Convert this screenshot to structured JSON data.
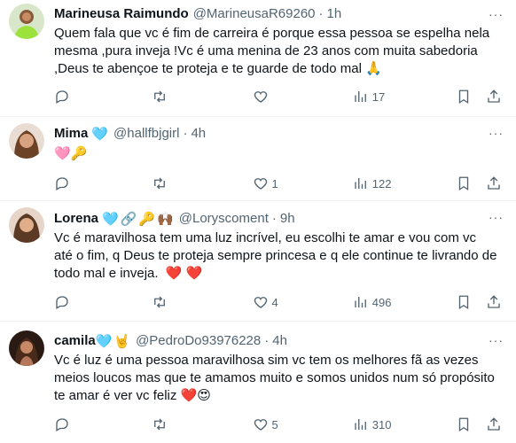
{
  "tweets": [
    {
      "name": "Marineusa Raimundo",
      "handle": "@MarineusaR69260",
      "time": "1h",
      "text": "Quem fala que vc é fim de carreira é porque essa pessoa se espelha nela mesma ,pura inveja !Vc é uma menina de 23 anos com muita sabedoria ,Deus te abençoe te proteja e te guarde de todo mal 🙏",
      "name_emojis": [],
      "reply_count": "",
      "retweet_count": "",
      "like_count": "",
      "view_count": "17",
      "avatar": "avatar-woman-green"
    },
    {
      "name": "Mima",
      "handle": "@hallfbjgirl",
      "time": "4h",
      "text": "🩷🔑",
      "name_emojis": [
        "🩵"
      ],
      "reply_count": "",
      "retweet_count": "",
      "like_count": "1",
      "view_count": "122",
      "avatar": "avatar-woman-brown"
    },
    {
      "name": "Lorena",
      "handle": "@Loryscoment",
      "time": "9h",
      "text": "Vc é maravilhosa tem uma luz incrível, eu escolhi te amar e vou com vc até o fim, q Deus te proteja sempre princesa e q ele continue te livrando de todo mal e inveja.  ❤️ ❤️",
      "name_emojis": [
        "🩵",
        "🔗",
        "🔑",
        "🙌🏾"
      ],
      "reply_count": "",
      "retweet_count": "",
      "like_count": "4",
      "view_count": "496",
      "avatar": "avatar-woman-smile"
    },
    {
      "name": "camila",
      "handle": "@PedroDo93976228",
      "time": "4h",
      "text": "Vc é luz é uma pessoa maravilhosa sim vc tem os melhores fã as vezes meios loucos mas que te amamos muito e somos unidos num só propósito te amar é ver vc feliz ❤️😍",
      "name_emojis": [
        "🩵",
        "🤘"
      ],
      "reply_count": "",
      "retweet_count": "",
      "like_count": "5",
      "view_count": "310",
      "avatar": "avatar-woman-dark"
    }
  ],
  "icons": {
    "reply": "reply-icon",
    "retweet": "retweet-icon",
    "like": "like-icon",
    "views": "views-icon",
    "bookmark": "bookmark-icon",
    "share": "share-icon",
    "more": "more-icon"
  },
  "colors": {
    "text": "#0f1419",
    "secondary": "#536471",
    "divider": "#eff3f4"
  }
}
